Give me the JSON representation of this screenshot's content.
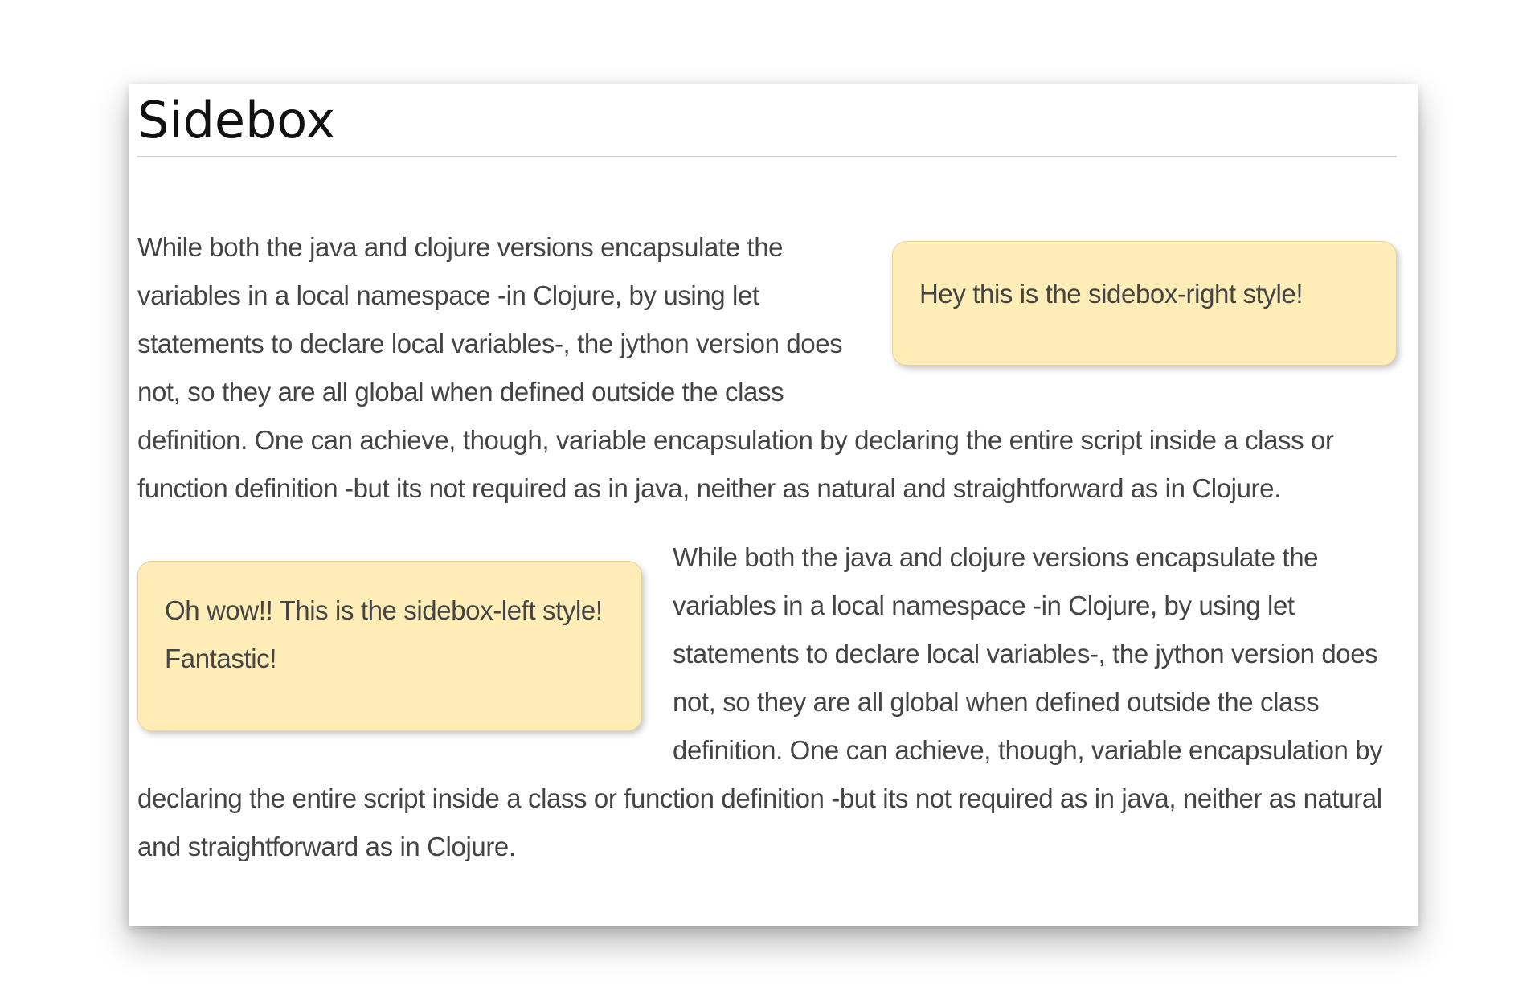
{
  "page": {
    "title": "Sidebox"
  },
  "sections": [
    {
      "sidebox_style": "right",
      "sidebox_text": "Hey this is the sidebox-right style!",
      "paragraph": "While both the java and clojure versions encapsulate the variables in a local namespace -in Clojure, by using let statements to declare local variables-, the jython version does not, so they are all global when defined outside the class definition. One can achieve, though, variable encapsulation by declaring the entire script inside a class or function definition -but its not required as in java, neither as natural and straightforward as in Clojure."
    },
    {
      "sidebox_style": "left",
      "sidebox_text": "Oh wow!! This is the sidebox-left style! Fantastic!",
      "paragraph": "While both the java and clojure versions encapsulate the variables in a local namespace -in Clojure, by using let statements to declare local variables-, the jython version does not, so they are all global when defined outside the class definition. One can achieve, though, variable encapsulation by declaring the entire script inside a class or function definition -but its not required as in java, neither as natural and straightforward as in Clojure."
    }
  ],
  "colors": {
    "sidebox_background": "#ffedb8",
    "text": "#444444",
    "heading": "#111111"
  }
}
